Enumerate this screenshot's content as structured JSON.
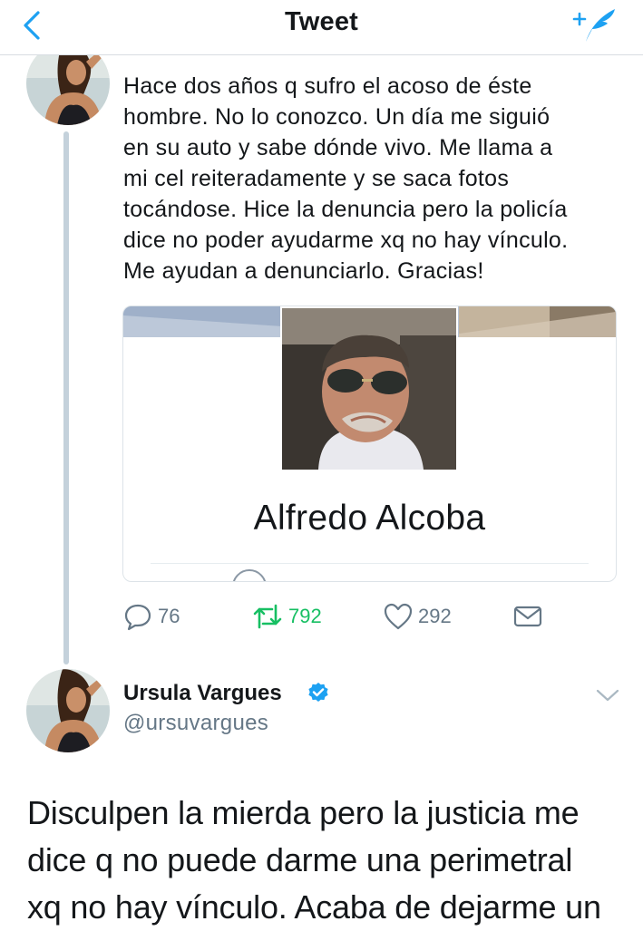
{
  "header": {
    "title": "Tweet",
    "back_icon": "chevron-left-icon",
    "compose_icon": "compose-tweet-icon",
    "accent_color": "#1da1f2"
  },
  "quoted_tweet": {
    "text_lines": [
      "Hace dos años q sufro el acoso de éste",
      "hombre. No lo conozco.  Un día me siguió",
      "en su auto y sabe dónde vivo. Me llama a",
      "mi cel reiteradamente y se saca fotos",
      "tocándose. Hice la denuncia pero la policía",
      "dice no poder ayudarme xq no hay vínculo.",
      "Me ayudan a denunciarlo. Gracias!"
    ],
    "card": {
      "profile_name": "Alfredo Alcoba"
    },
    "actions": {
      "replies": "76",
      "retweets": "792",
      "likes": "292",
      "retweet_color": "#17bf63",
      "icon_color": "#657786"
    }
  },
  "main_tweet": {
    "author_name": "Ursula Vargues",
    "author_handle": "@ursuvargues",
    "verified": true,
    "text_lines": [
      "Disculpen la mierda pero la justicia me",
      "dice q no puede darme una perimetral",
      "xq no hay vínculo. Acaba de dejarme un"
    ]
  }
}
